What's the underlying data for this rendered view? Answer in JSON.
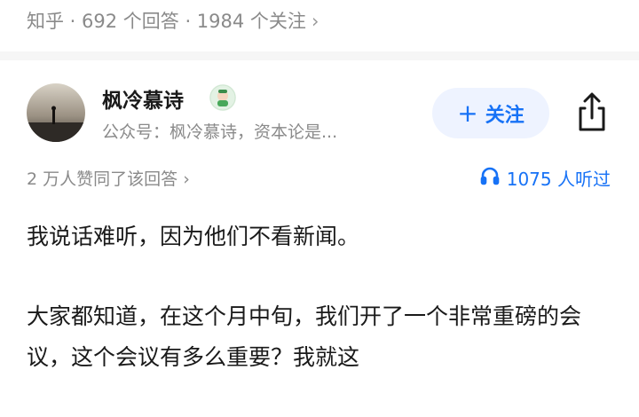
{
  "header": {
    "breadcrumb": "知乎 · 692 个回答 · 1984 个关注",
    "chevron": "›"
  },
  "author": {
    "name": "枫冷慕诗",
    "subtitle": "公众号：枫冷慕诗，资本论是...",
    "follow_label": "关注",
    "follow_plus": "+"
  },
  "stats": {
    "upvote_text": "2 万人赞同了该回答",
    "listen_text": "1075 人听过"
  },
  "content": {
    "paragraphs": [
      "我说话难听，因为他们不看新闻。",
      "大家都知道，在这个月中旬，我们开了一个非常重磅的会议，这个会议有多么重要？我就这"
    ]
  },
  "colors": {
    "accent": "#1772f6",
    "muted": "#8a8a8a",
    "follow_bg": "#eef3ff"
  }
}
